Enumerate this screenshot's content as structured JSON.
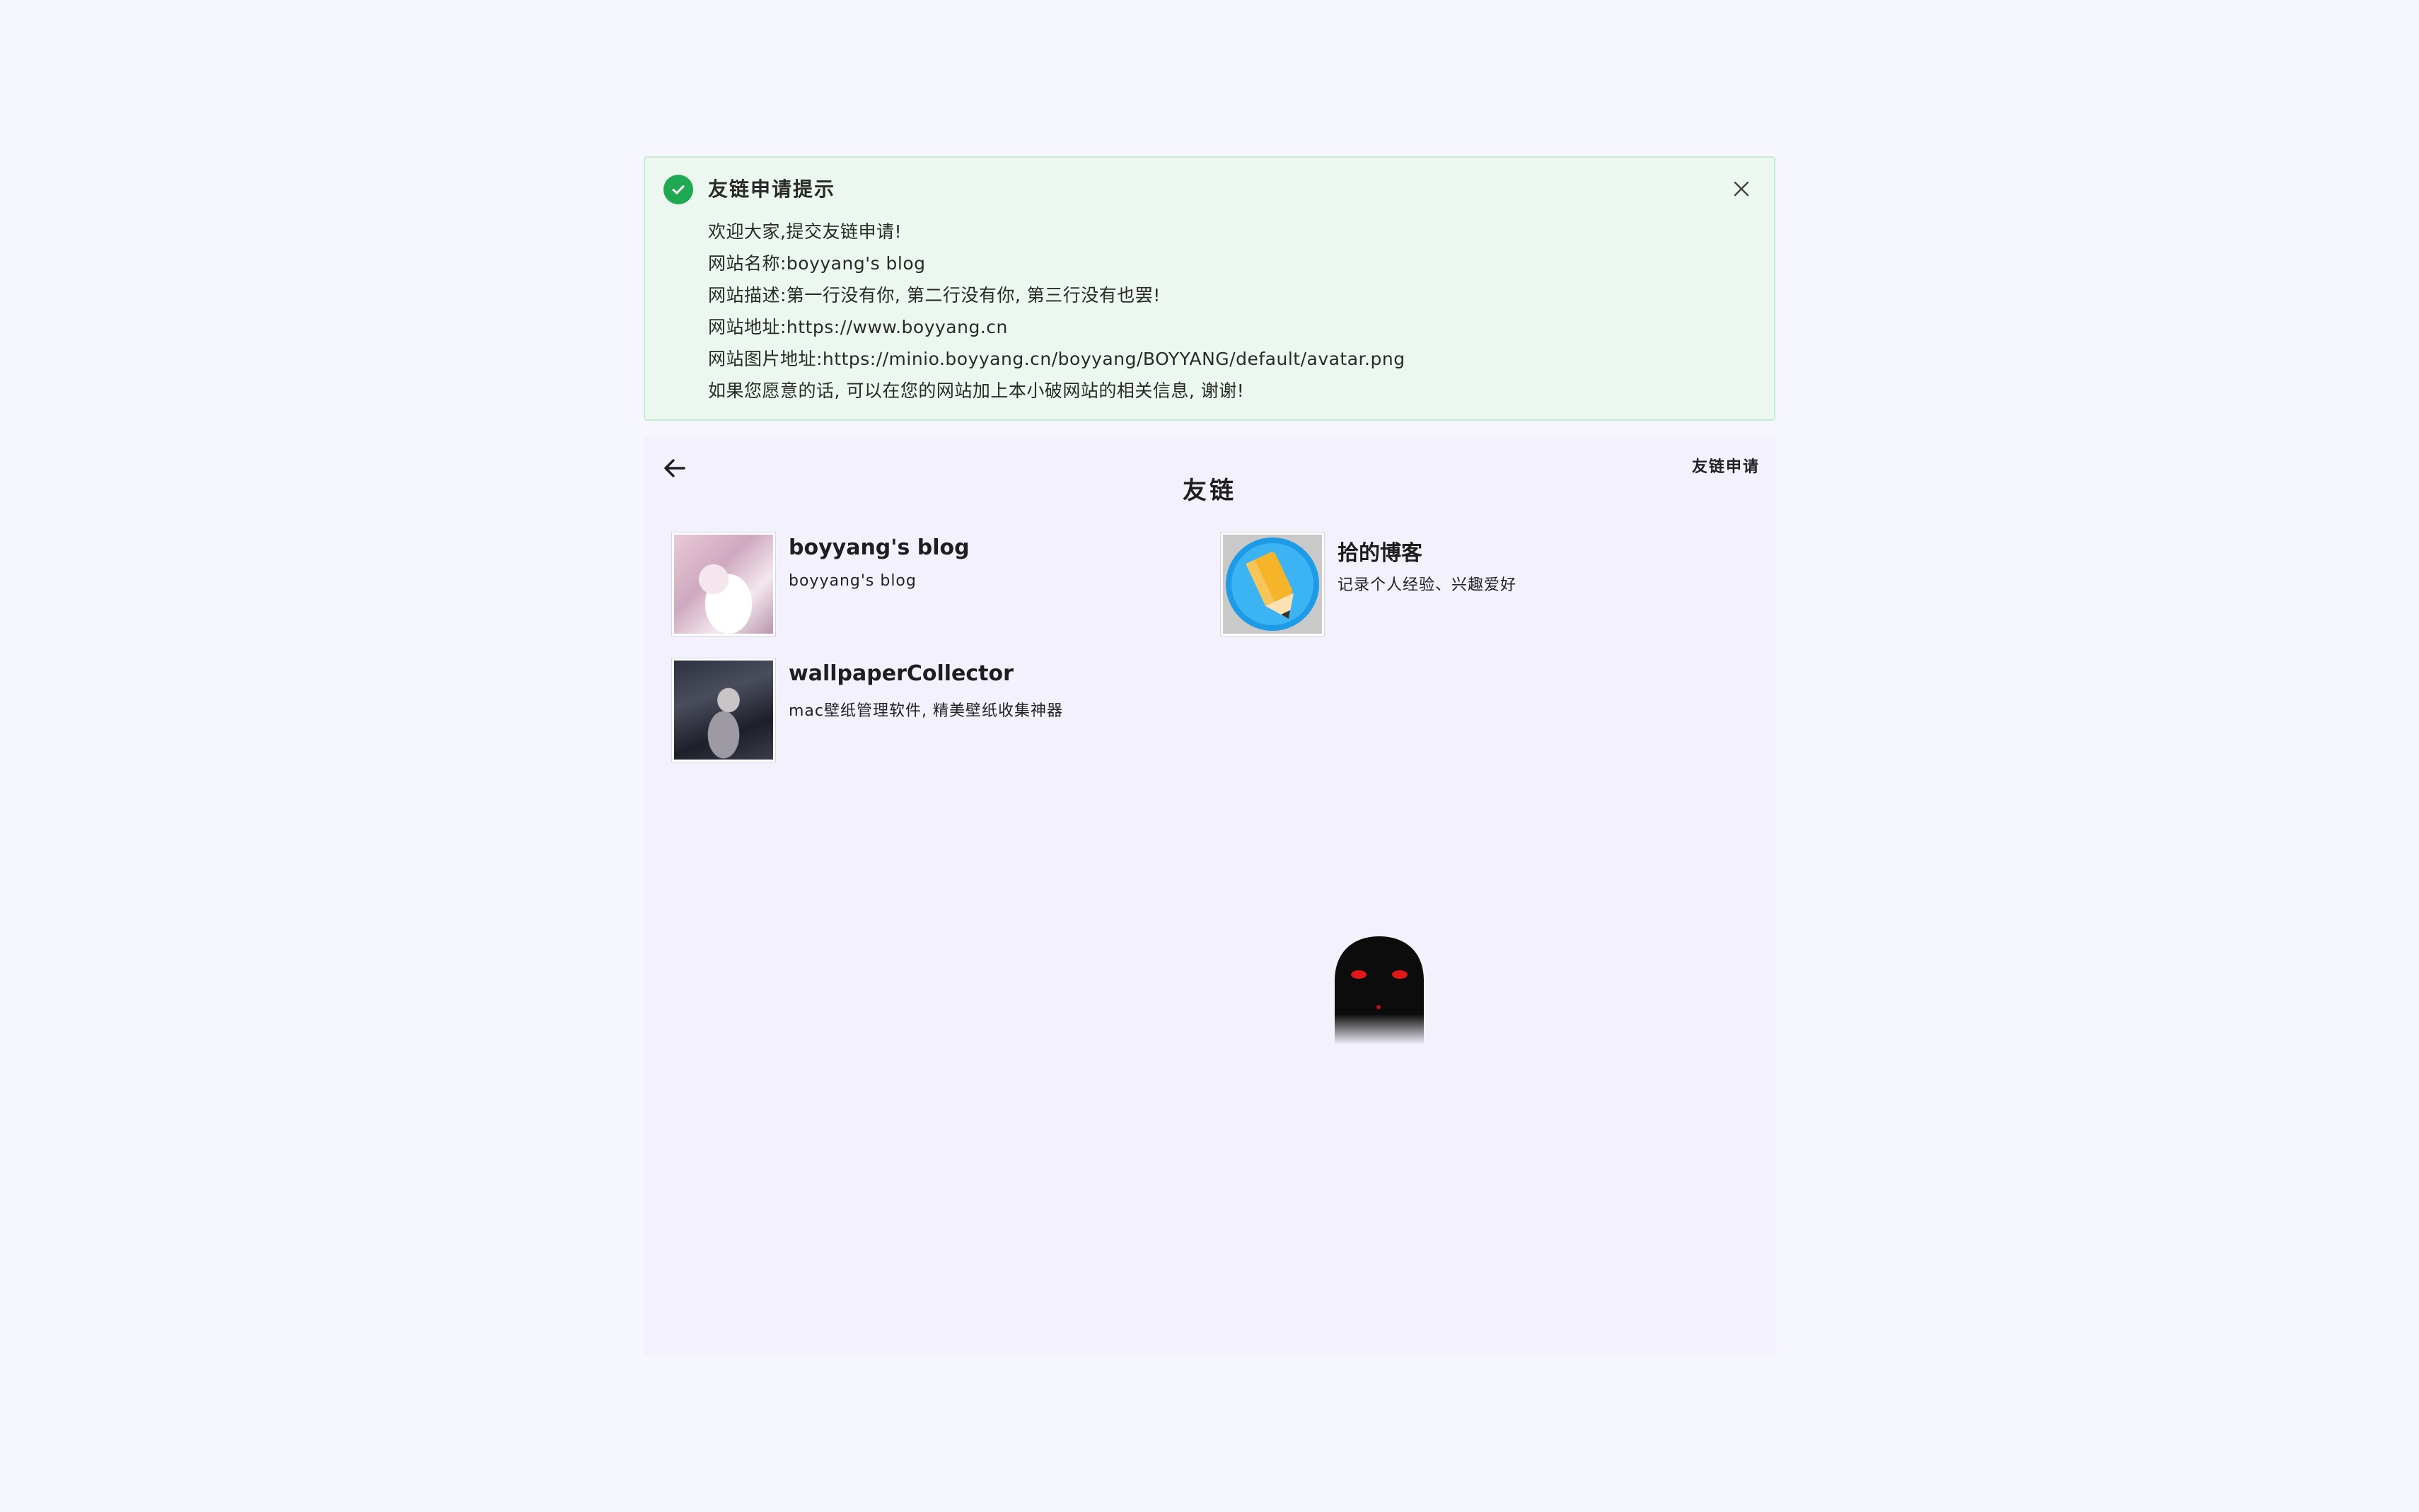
{
  "notice": {
    "title": "友链申请提示",
    "lines": [
      "欢迎大家,提交友链申请!",
      "网站名称:boyyang's blog",
      "网站描述:第一行没有你, 第二行没有你, 第三行没有也罢!",
      "网站地址:https://www.boyyang.cn",
      "网站图片地址:https://minio.boyyang.cn/boyyang/BOYYANG/default/avatar.png",
      "如果您愿意的话, 可以在您的网站加上本小破网站的相关信息, 谢谢!"
    ],
    "icons": {
      "status": "check-circle-icon",
      "close": "close-icon"
    },
    "colors": {
      "background": "#ecf7ef",
      "border": "#c9ead3",
      "success": "#20a852"
    }
  },
  "page": {
    "title": "友链",
    "apply_label": "友链申请",
    "back_icon": "arrow-left-icon",
    "background": "#f2f1fc"
  },
  "links": [
    {
      "name": "boyyang's blog",
      "description": "boyyang's blog",
      "avatar": "anime-girl-pink-avatar"
    },
    {
      "name": "拾的博客",
      "description": "记录个人经验、兴趣爱好",
      "avatar": "pencil-logo-avatar"
    },
    {
      "name": "wallpaperCollector",
      "description": "mac壁纸管理软件, 精美壁纸收集神器",
      "avatar": "dark-anime-girl-avatar"
    }
  ],
  "mascot": "ghost-icon"
}
